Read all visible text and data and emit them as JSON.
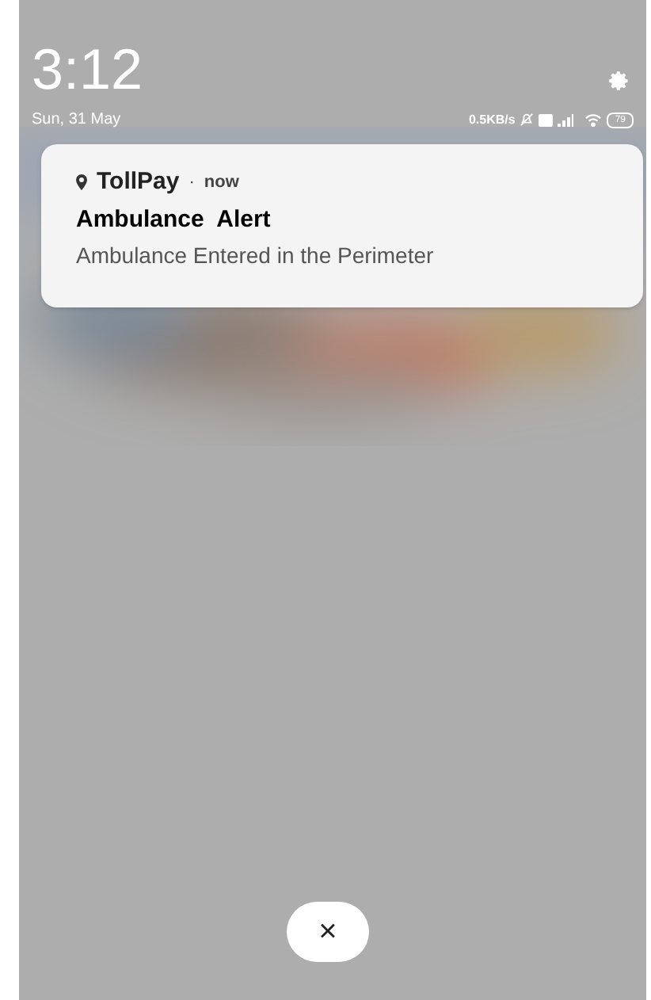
{
  "status_bar": {
    "time": "3:12",
    "date": "Sun, 31 May",
    "network_speed": "0.5KB/s",
    "battery": "79"
  },
  "notification": {
    "app": "TollPay",
    "separator": "·",
    "when": "now",
    "title": "Ambulance  Alert",
    "body": "Ambulance Entered in the Perimeter"
  },
  "dismiss_button": {
    "label": "×"
  }
}
